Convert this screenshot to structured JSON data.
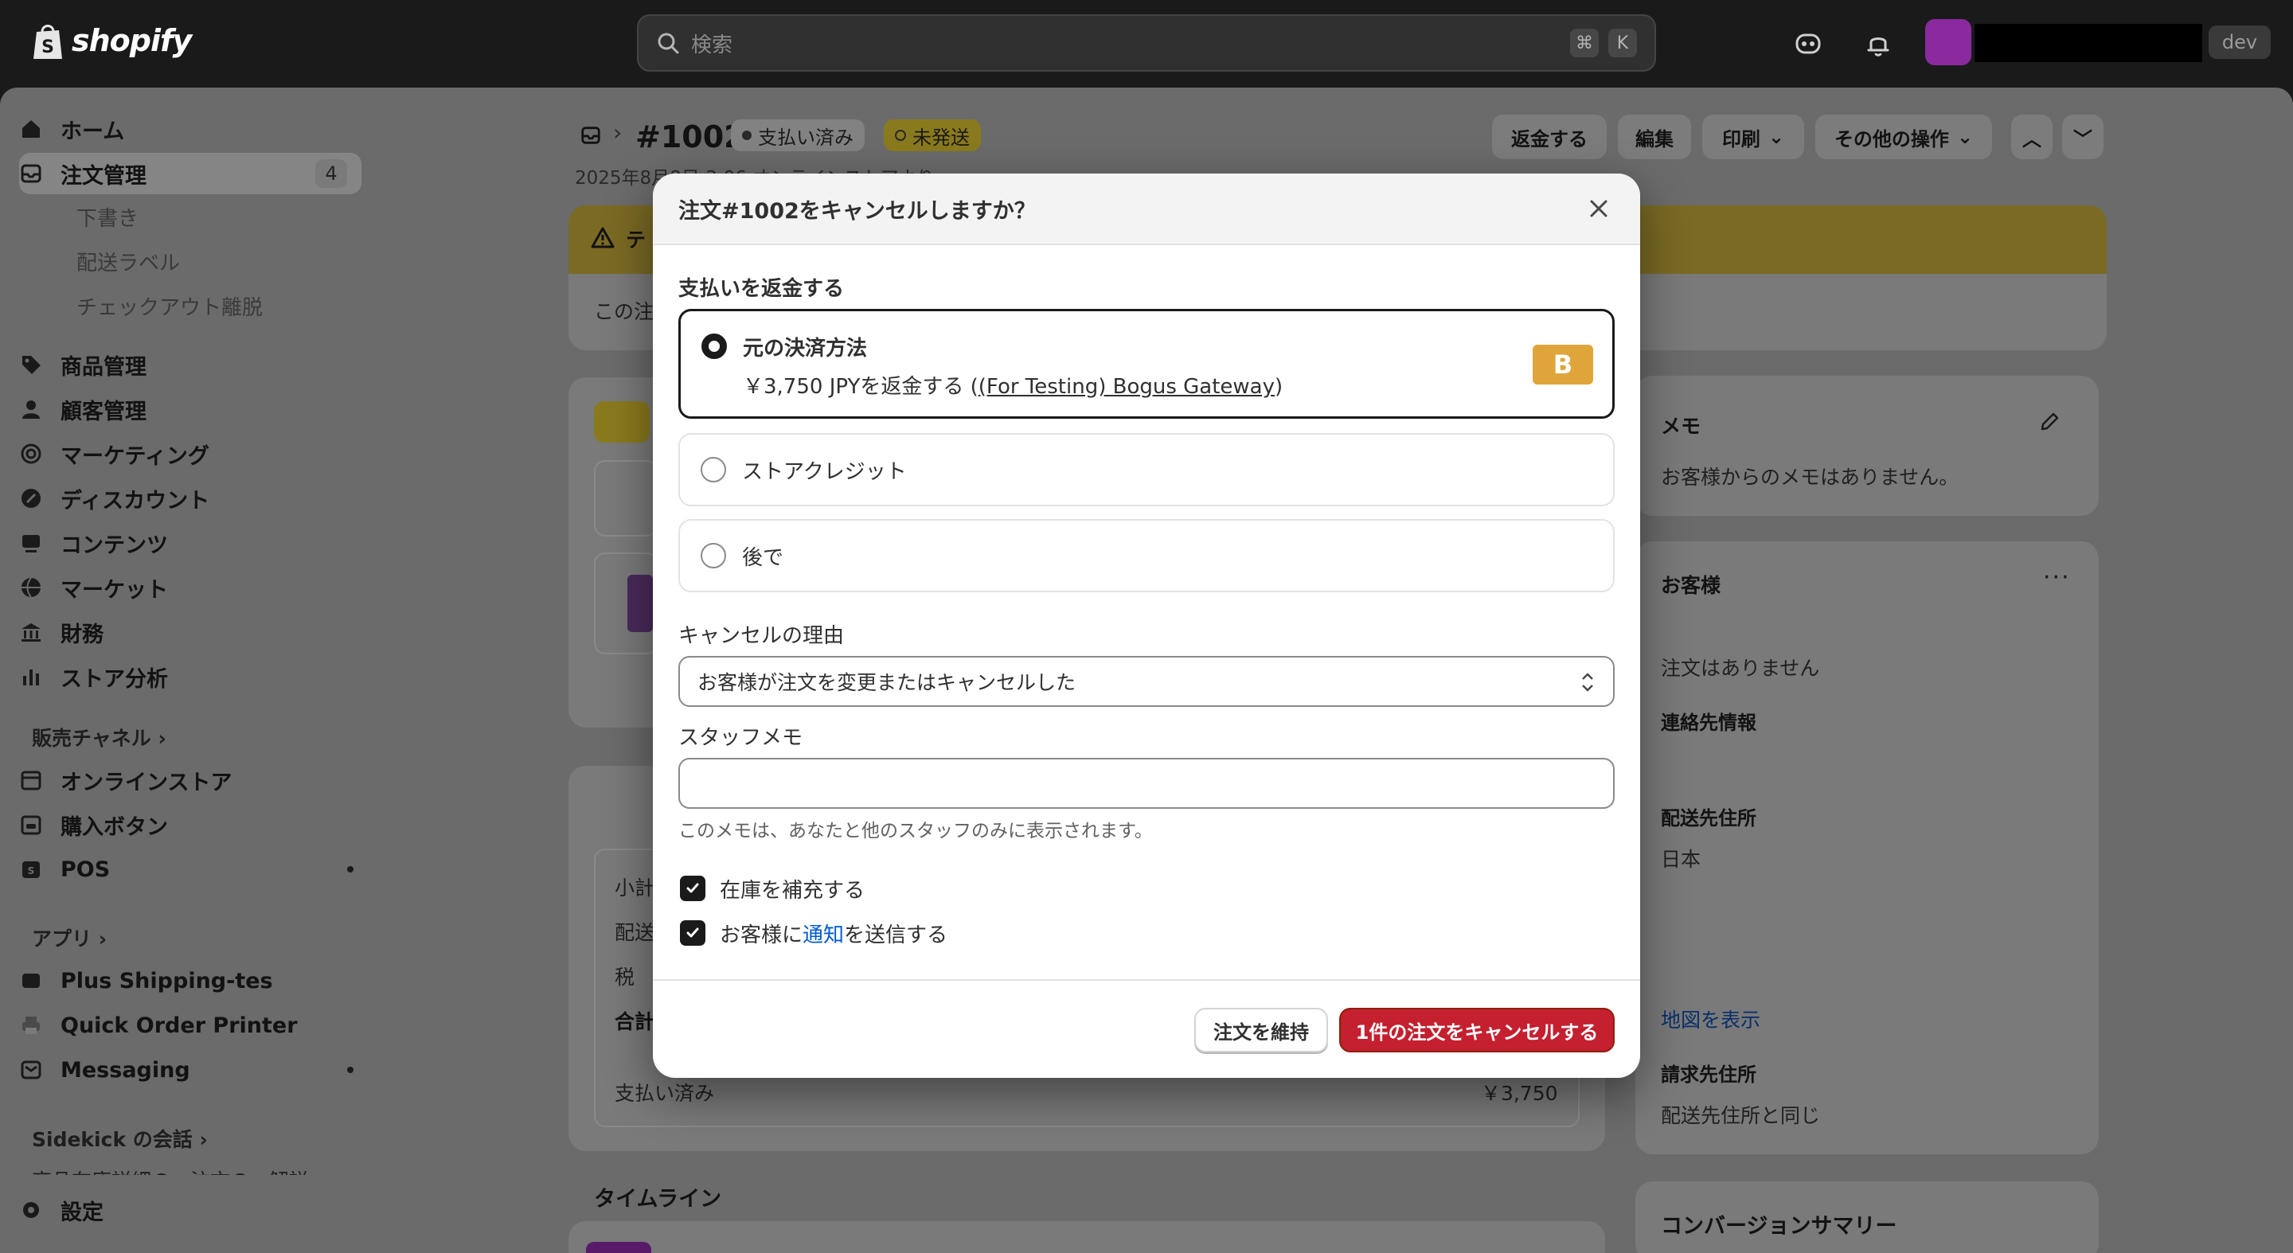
{
  "topbar": {
    "brand": "shopify",
    "search_placeholder": "検索",
    "shortcut_cmd": "⌘",
    "shortcut_key": "K",
    "store_tag": "dev"
  },
  "sidebar": {
    "items": [
      {
        "label": "ホーム",
        "icon": "home-icon"
      },
      {
        "label": "注文管理",
        "icon": "orders-icon",
        "badge": "4"
      },
      {
        "label": "商品管理",
        "icon": "tag-icon"
      },
      {
        "label": "顧客管理",
        "icon": "person-icon"
      },
      {
        "label": "マーケティング",
        "icon": "target-icon"
      },
      {
        "label": "ディスカウント",
        "icon": "discount-icon"
      },
      {
        "label": "コンテンツ",
        "icon": "content-icon"
      },
      {
        "label": "マーケット",
        "icon": "globe-icon"
      },
      {
        "label": "財務",
        "icon": "bank-icon"
      },
      {
        "label": "ストア分析",
        "icon": "chart-icon"
      }
    ],
    "order_subitems": [
      "下書き",
      "配送ラベル",
      "チェックアウト離脱"
    ],
    "sales_channels_title": "販売チャネル",
    "channels": [
      "オンラインストア",
      "購入ボタン",
      "POS"
    ],
    "apps_title": "アプリ",
    "apps": [
      "Plus Shipping-tes",
      "Quick Order Printer",
      "Messaging"
    ],
    "sidekick_title": "Sidekick の会話",
    "sidekick_truncated": "商品在庫詳細の...注文の...解説",
    "settings_label": "設定"
  },
  "order_header": {
    "order_number": "#1002",
    "paid_badge": "支払い済み",
    "unfulfilled_badge": "未発送",
    "date_line": "2025年8月8日 3:06 オンラインストアより",
    "actions": {
      "refund": "返金する",
      "edit": "編集",
      "print": "印刷",
      "more": "その他の操作"
    }
  },
  "background_cards": {
    "warning_prefix": "テ",
    "notice_prefix": "この注",
    "summary_rows": [
      "小計",
      "配送",
      "税",
      "合計"
    ],
    "paid_label": "支払い済み",
    "paid_amount": "￥3,750",
    "timeline_title": "タイムライン",
    "note_title": "メモ",
    "note_empty": "お客様からのメモはありません。",
    "customer_title": "お客様",
    "customer_no_orders": "注文はありません",
    "contact_title": "連絡先情報",
    "shipping_title": "配送先住所",
    "shipping_country": "日本",
    "map_link": "地図を表示",
    "billing_title": "請求先住所",
    "billing_same": "配送先住所と同じ",
    "conversion_title": "コンバージョンサマリー"
  },
  "modal": {
    "title": "注文#1002をキャンセルしますか？",
    "refund_section_label": "支払いを返金する",
    "options": [
      {
        "label": "元の決済方法",
        "selected": true,
        "sub_prefix": "￥3,750 JPYを返金する (",
        "sub_link": "(For Testing) Bogus Gateway",
        "sub_suffix": ")",
        "badge": "B"
      },
      {
        "label": "ストアクレジット",
        "selected": false
      },
      {
        "label": "後で",
        "selected": false
      }
    ],
    "reason_label": "キャンセルの理由",
    "reason_value": "お客様が注文を変更またはキャンセルした",
    "staff_note_label": "スタッフメモ",
    "staff_note_value": "",
    "staff_note_help": "このメモは、あなたと他のスタッフのみに表示されます。",
    "restock_label": "在庫を補充する",
    "restock_checked": true,
    "notify_prefix": "お客様に",
    "notify_link": "通知",
    "notify_suffix": "を送信する",
    "notify_checked": true,
    "keep_button": "注文を維持",
    "cancel_button": "1件の注文をキャンセルする"
  }
}
